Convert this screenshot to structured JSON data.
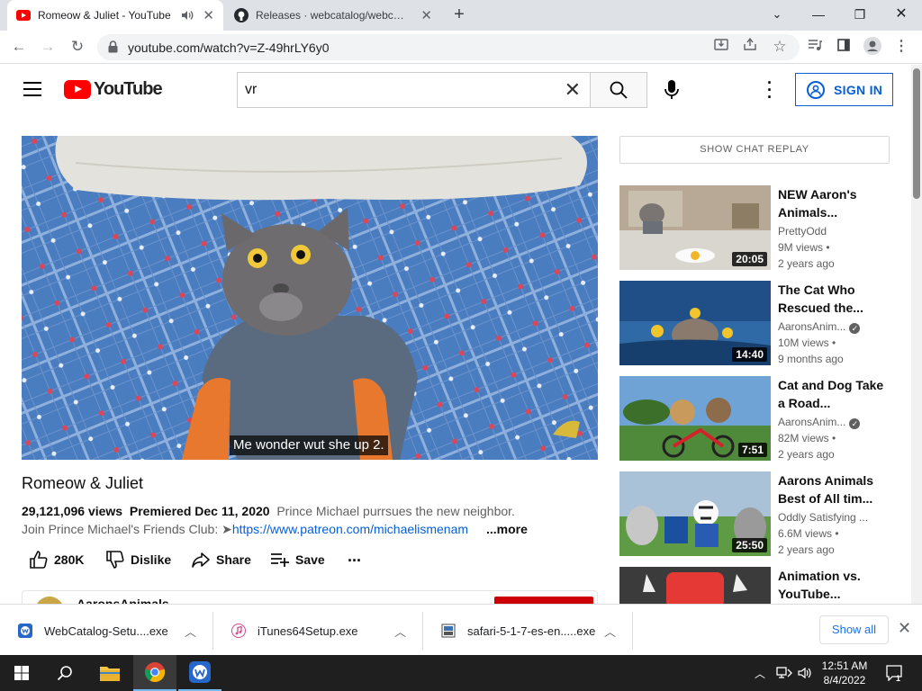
{
  "browser": {
    "tabs": [
      {
        "title": "Romeow & Juliet - YouTube",
        "active": true
      },
      {
        "title": "Releases · webcatalog/webcatalog",
        "active": false
      }
    ],
    "new_tab_label": "+",
    "url": "youtube.com/watch?v=Z-49hrLY6y0"
  },
  "youtube": {
    "logo_text": "YouTube",
    "search": {
      "value": "vr",
      "placeholder": "Search"
    },
    "sign_in_label": "SIGN IN"
  },
  "video": {
    "caption": "Me wonder wut she up 2.",
    "title": "Romeow & Juliet",
    "views": "29,121,096 views",
    "premiered": "Premiered Dec 11, 2020",
    "description_line1": "Prince Michael purrsues the new neighbor.",
    "description_line2_prefix": "Join Prince Michael's Friends Club: ➤",
    "description_link": "https://www.patreon.com/michaelismenam",
    "more_label": "...more",
    "likes": "280K",
    "dislike_label": "Dislike",
    "share_label": "Share",
    "save_label": "Save",
    "more_actions": "...",
    "channel_name": "AaronsAnimals"
  },
  "sidebar": {
    "chat_replay_label": "SHOW CHAT REPLAY",
    "recommendations": [
      {
        "title": "NEW Aaron's Animals...",
        "channel": "PrettyOdd",
        "verified": false,
        "views": "9M views",
        "age": "2 years ago",
        "duration": "20:05"
      },
      {
        "title": "The Cat Who Rescued the...",
        "channel": "AaronsAnim...",
        "verified": true,
        "views": "10M views",
        "age": "9 months ago",
        "duration": "14:40"
      },
      {
        "title": "Cat and Dog Take a Road...",
        "channel": "AaronsAnim...",
        "verified": true,
        "views": "82M views",
        "age": "2 years ago",
        "duration": "7:51"
      },
      {
        "title": "Aarons Animals Best of All tim...",
        "channel": "Oddly Satisfying ...",
        "verified": false,
        "views": "6.6M views",
        "age": "2 years ago",
        "duration": "25:50"
      },
      {
        "title": "Animation vs. YouTube...",
        "channel": "",
        "verified": false,
        "views": "",
        "age": "",
        "duration": ""
      }
    ]
  },
  "downloads": {
    "items": [
      {
        "name": "WebCatalog-Setu....exe"
      },
      {
        "name": "iTunes64Setup.exe"
      },
      {
        "name": "safari-5-1-7-es-en.....exe"
      }
    ],
    "show_all_label": "Show all"
  },
  "taskbar": {
    "time": "12:51 AM",
    "date": "8/4/2022",
    "notification_count": "1"
  },
  "colors": {
    "youtube_red": "#ff0000",
    "link_blue": "#065fd4",
    "chrome_tabstrip": "#dee1e6"
  }
}
